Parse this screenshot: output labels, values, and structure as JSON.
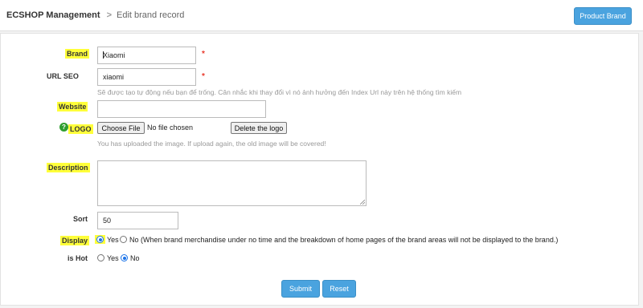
{
  "header": {
    "app_title": "ECSHOP Management",
    "separator": ">",
    "page_title": "Edit brand record",
    "product_brand_label": "Product Brand"
  },
  "form": {
    "brand": {
      "label": "Brand",
      "value": "Xiaomi",
      "required_mark": "*"
    },
    "url_seo": {
      "label": "URL SEO",
      "value": "xiaomi",
      "required_mark": "*",
      "hint": "Sẽ được tạo tự động nếu bạn để trống. Cân nhắc khi thay đổi vì nó ảnh hưởng đến Index Url này trên hệ thống tìm kiếm"
    },
    "website": {
      "label": "Website",
      "value": ""
    },
    "logo": {
      "label": "LOGO",
      "choose_file_label": "Choose File",
      "file_status": "No file chosen",
      "delete_label": "Delete the logo",
      "hint": "You has uploaded the image. If upload again, the old image will be covered!"
    },
    "description": {
      "label": "Description",
      "value": ""
    },
    "sort": {
      "label": "Sort",
      "value": "50"
    },
    "display": {
      "label": "Display",
      "yes_label": "Yes",
      "no_label": "No (When brand merchandise under no time and the breakdown of home pages of the brand areas will not be displayed to the brand.)",
      "selected": "yes"
    },
    "is_hot": {
      "label": "is Hot",
      "yes_label": "Yes",
      "no_label": "No",
      "selected": "no"
    }
  },
  "actions": {
    "submit_label": "Submit",
    "reset_label": "Reset"
  },
  "colors": {
    "highlight": "#ffff3a",
    "primary_button": "#4aa3df",
    "required": "#e8392c",
    "radio_selected": "#1a73e8",
    "help_icon": "#2f9e2f"
  },
  "icons": {
    "help": "question-circle-icon"
  }
}
